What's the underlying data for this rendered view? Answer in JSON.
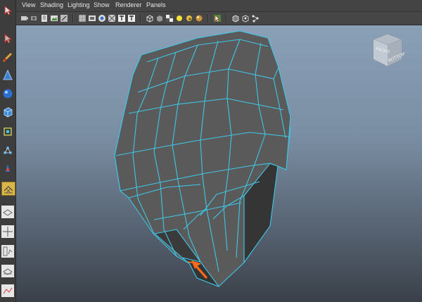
{
  "menu": {
    "view": "View",
    "shading": "Shading",
    "lighting": "Lighting",
    "show": "Show",
    "renderer": "Renderer",
    "panels": "Panels"
  },
  "viewcube": {
    "front_label": "FRONT",
    "bottom_label": "BOTTOM"
  },
  "toolbox_icons": [
    "select-tool-icon",
    "lasso-tool-icon",
    "paint-select-icon",
    "move-tool-icon",
    "sphere-primitive-icon",
    "cube-primitive-icon",
    "scale-tool-icon",
    "show-manipulator-icon",
    "last-tool-icon",
    "single-perspective-layout-icon",
    "four-view-layout-icon",
    "persp-outliner-layout-icon",
    "graph-layout-icon",
    "hypershade-layout-icon"
  ],
  "colors": {
    "wire": "#3fc6e6",
    "mesh_fill": "#5a5a5a",
    "accent_arrow": "#ff6a1a"
  }
}
